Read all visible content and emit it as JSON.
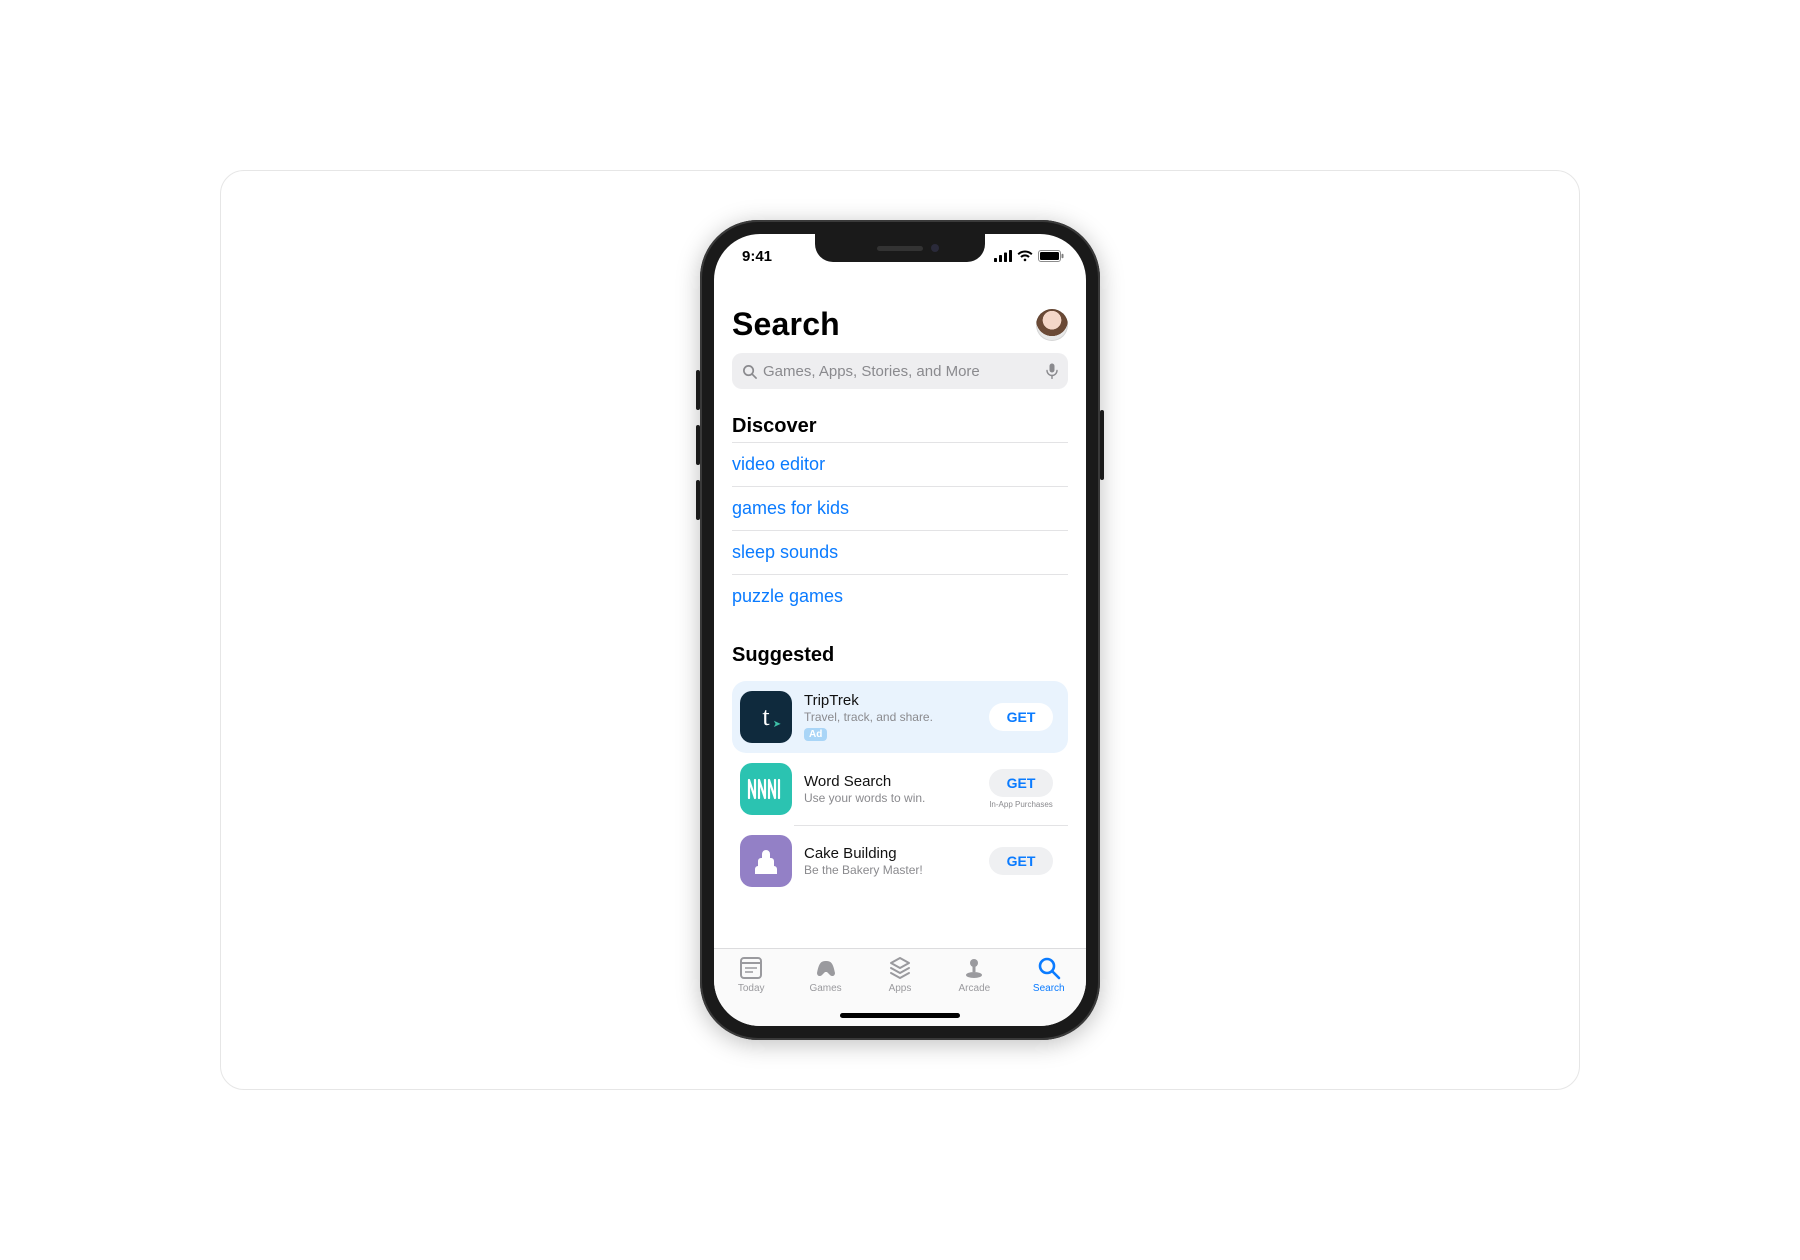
{
  "status": {
    "time": "9:41"
  },
  "header": {
    "title": "Search"
  },
  "search": {
    "placeholder": "Games, Apps, Stories, and More"
  },
  "discover": {
    "heading": "Discover",
    "items": [
      "video editor",
      "games for kids",
      "sleep sounds",
      "puzzle games"
    ]
  },
  "suggested": {
    "heading": "Suggested",
    "apps": [
      {
        "name": "TripTrek",
        "subtitle": "Travel, track, and share.",
        "action": "GET",
        "ad_label": "Ad",
        "sponsored": true,
        "iap": ""
      },
      {
        "name": "Word Search",
        "subtitle": "Use your words to win.",
        "action": "GET",
        "iap": "In-App Purchases",
        "sponsored": false
      },
      {
        "name": "Cake Building",
        "subtitle": "Be the Bakery Master!",
        "action": "GET",
        "iap": "",
        "sponsored": false
      }
    ]
  },
  "tabbar": {
    "items": [
      {
        "label": "Today",
        "active": false
      },
      {
        "label": "Games",
        "active": false
      },
      {
        "label": "Apps",
        "active": false
      },
      {
        "label": "Arcade",
        "active": false
      },
      {
        "label": "Search",
        "active": true
      }
    ]
  }
}
